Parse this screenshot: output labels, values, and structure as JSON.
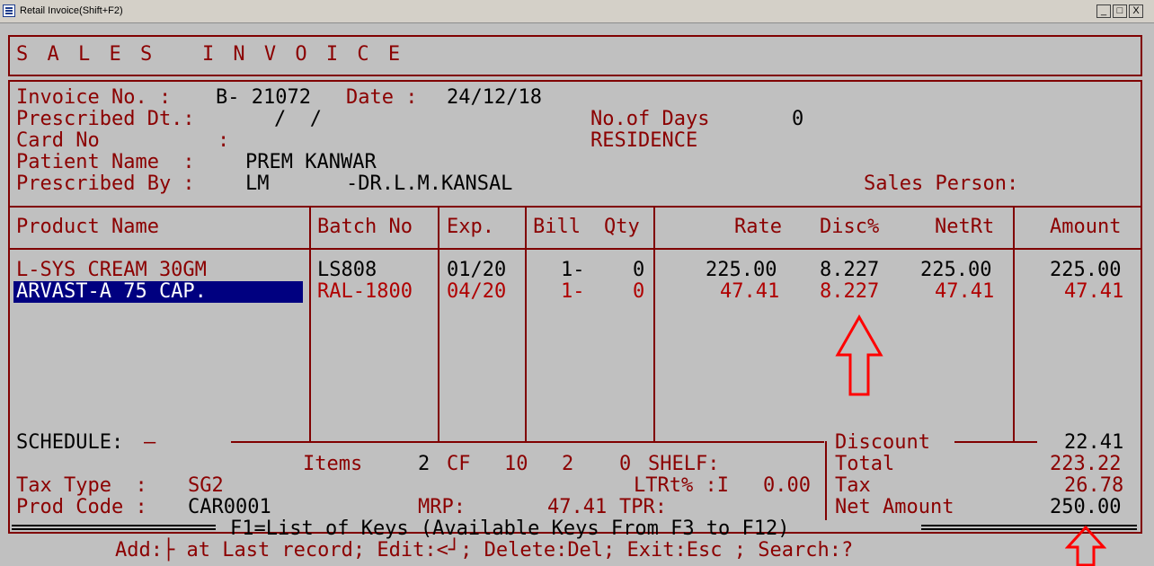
{
  "window": {
    "title": "Retail Invoice(Shift+F2)",
    "min": "_",
    "max": "□",
    "close": "X"
  },
  "banner": "S A L E S   I N V O I C E",
  "header": {
    "invoice_label": "Invoice No. :",
    "invoice_no": "B- 21072",
    "date_label": "Date :",
    "date": "24/12/18",
    "prescribed_dt_label": "Prescribed Dt.:",
    "prescribed_dt": "/  /",
    "days_label": "No.of Days",
    "days": "0",
    "card_label": "Card No",
    "card_colon": ":",
    "residence": "RESIDENCE",
    "patient_label": "Patient Name  :",
    "patient": "PREM KANWAR",
    "prescribed_by_label": "Prescribed By :",
    "prescribed_code": "LM",
    "doctor": "-DR.L.M.KANSAL",
    "sales_person_label": "Sales Person:"
  },
  "table": {
    "columns": [
      "Product Name",
      "Batch No",
      "Exp.",
      "Bill",
      "Qty",
      "Rate",
      "Disc%",
      "NetRt",
      "Amount"
    ],
    "rows": [
      {
        "product": "L-SYS CREAM 30GM",
        "batch": "LS808",
        "exp": "01/20",
        "bill": "1-",
        "qty": "0",
        "rate": "225.00",
        "disc": "8.227",
        "netrt": "225.00",
        "amount": "225.00"
      },
      {
        "product": "ARVAST-A 75 CAP.",
        "batch": "RAL-1800",
        "exp": "04/20",
        "bill": "1-",
        "qty": "0",
        "rate": "47.41",
        "disc": "8.227",
        "netrt": "47.41",
        "amount": "47.41"
      }
    ]
  },
  "footer": {
    "schedule_label": "SCHEDULE:",
    "schedule_value": "–",
    "items_label": "Items",
    "items": "2",
    "cf_label": "CF",
    "cf1": "10",
    "cf2": "2",
    "cf3": "0",
    "shelf_label": "SHELF:",
    "ltrt_label": "LTRt% :I",
    "ltrt": "0.00",
    "tax_type_label": "Tax Type  :",
    "tax_type": "SG2",
    "prod_code_label": "Prod Code :",
    "prod_code": "CAR0001",
    "mrp_label": "MRP:",
    "mrp": "47.41",
    "tpr_label": "TPR:",
    "discount_label": "Discount",
    "discount": "22.41",
    "total_label": "Total",
    "total": "223.22",
    "tax_label": "Tax",
    "tax": "26.78",
    "net_label": "Net Amount",
    "net": "250.00"
  },
  "help_line": "F1=List of Keys (Available Keys From F3 to F12)",
  "status_line": "Add:├ at Last record; Edit:<┘; Delete:Del; Exit:Esc ; Search:?",
  "colors": {
    "background": "#c0c0c0",
    "text": "#8b0000",
    "border": "#800000",
    "selection": "#000080",
    "annotation": "#ff0000"
  }
}
